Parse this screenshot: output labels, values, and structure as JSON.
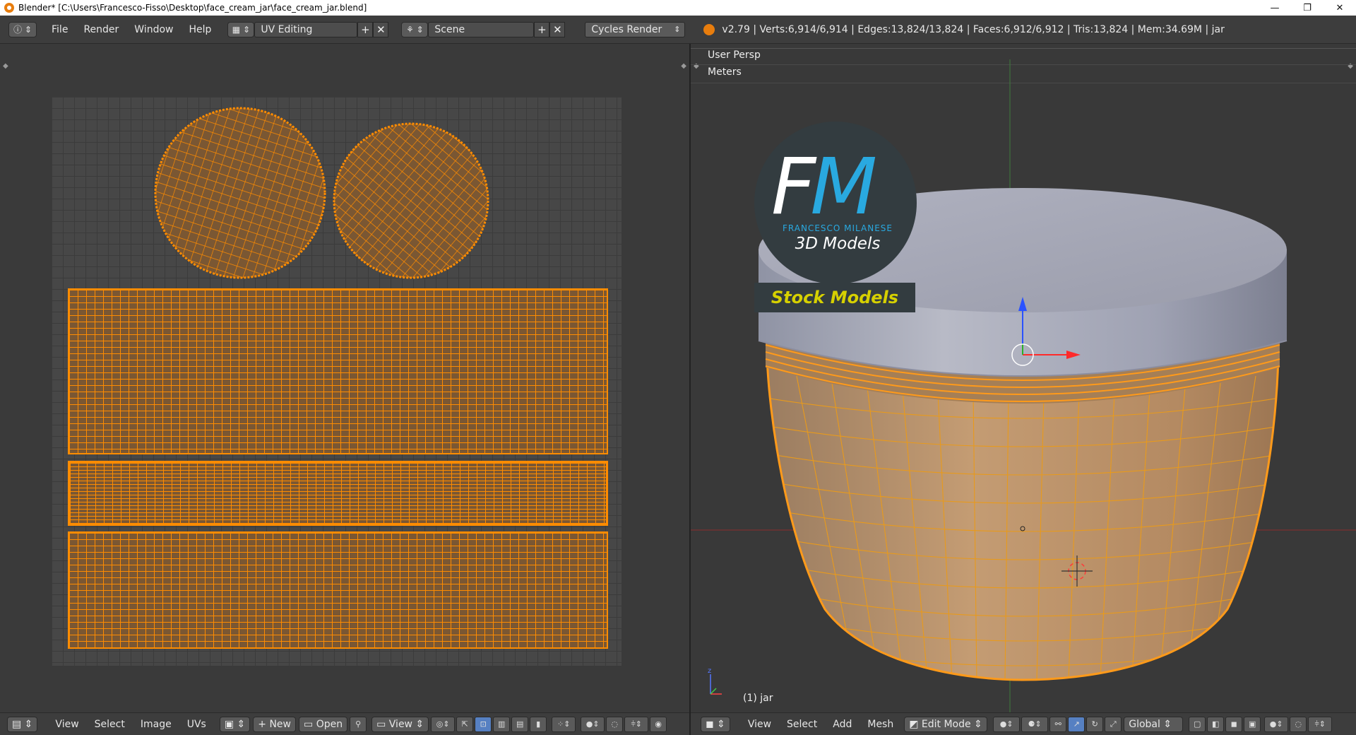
{
  "window": {
    "title": "Blender* [C:\\Users\\Francesco-Fisso\\Desktop\\face_cream_jar\\face_cream_jar.blend]",
    "minimize": "—",
    "restore": "❐",
    "close": "✕"
  },
  "info_header": {
    "menus": [
      "File",
      "Render",
      "Window",
      "Help"
    ],
    "screen_layout": "UV Editing",
    "scene": "Scene",
    "render_engine": "Cycles Render",
    "stats": "v2.79 | Verts:6,914/6,914 | Edges:13,824/13,824 | Faces:6,912/6,912 | Tris:13,824 | Mem:34.69M | jar"
  },
  "viewport": {
    "view_name": "User Persp",
    "units": "Meters",
    "object_label": "(1) jar"
  },
  "watermark": {
    "letters_f": "F",
    "letters_m": "M",
    "subtitle": "FRANCESCO MILANESE",
    "tagline": "3D Models",
    "banner": "Stock Models"
  },
  "uv_footer": {
    "menus": [
      "View",
      "Select",
      "Image",
      "UVs"
    ],
    "new_label": "New",
    "open_label": "Open",
    "view_label": "View"
  },
  "view3d_footer": {
    "menus": [
      "View",
      "Select",
      "Add",
      "Mesh"
    ],
    "mode": "Edit Mode",
    "orientation": "Global"
  },
  "colors": {
    "selection_orange": "#ff8c00",
    "uv_face_fill": "#7a5733",
    "watermark_blue": "#29a9e0",
    "watermark_yellow": "#d6d000"
  }
}
